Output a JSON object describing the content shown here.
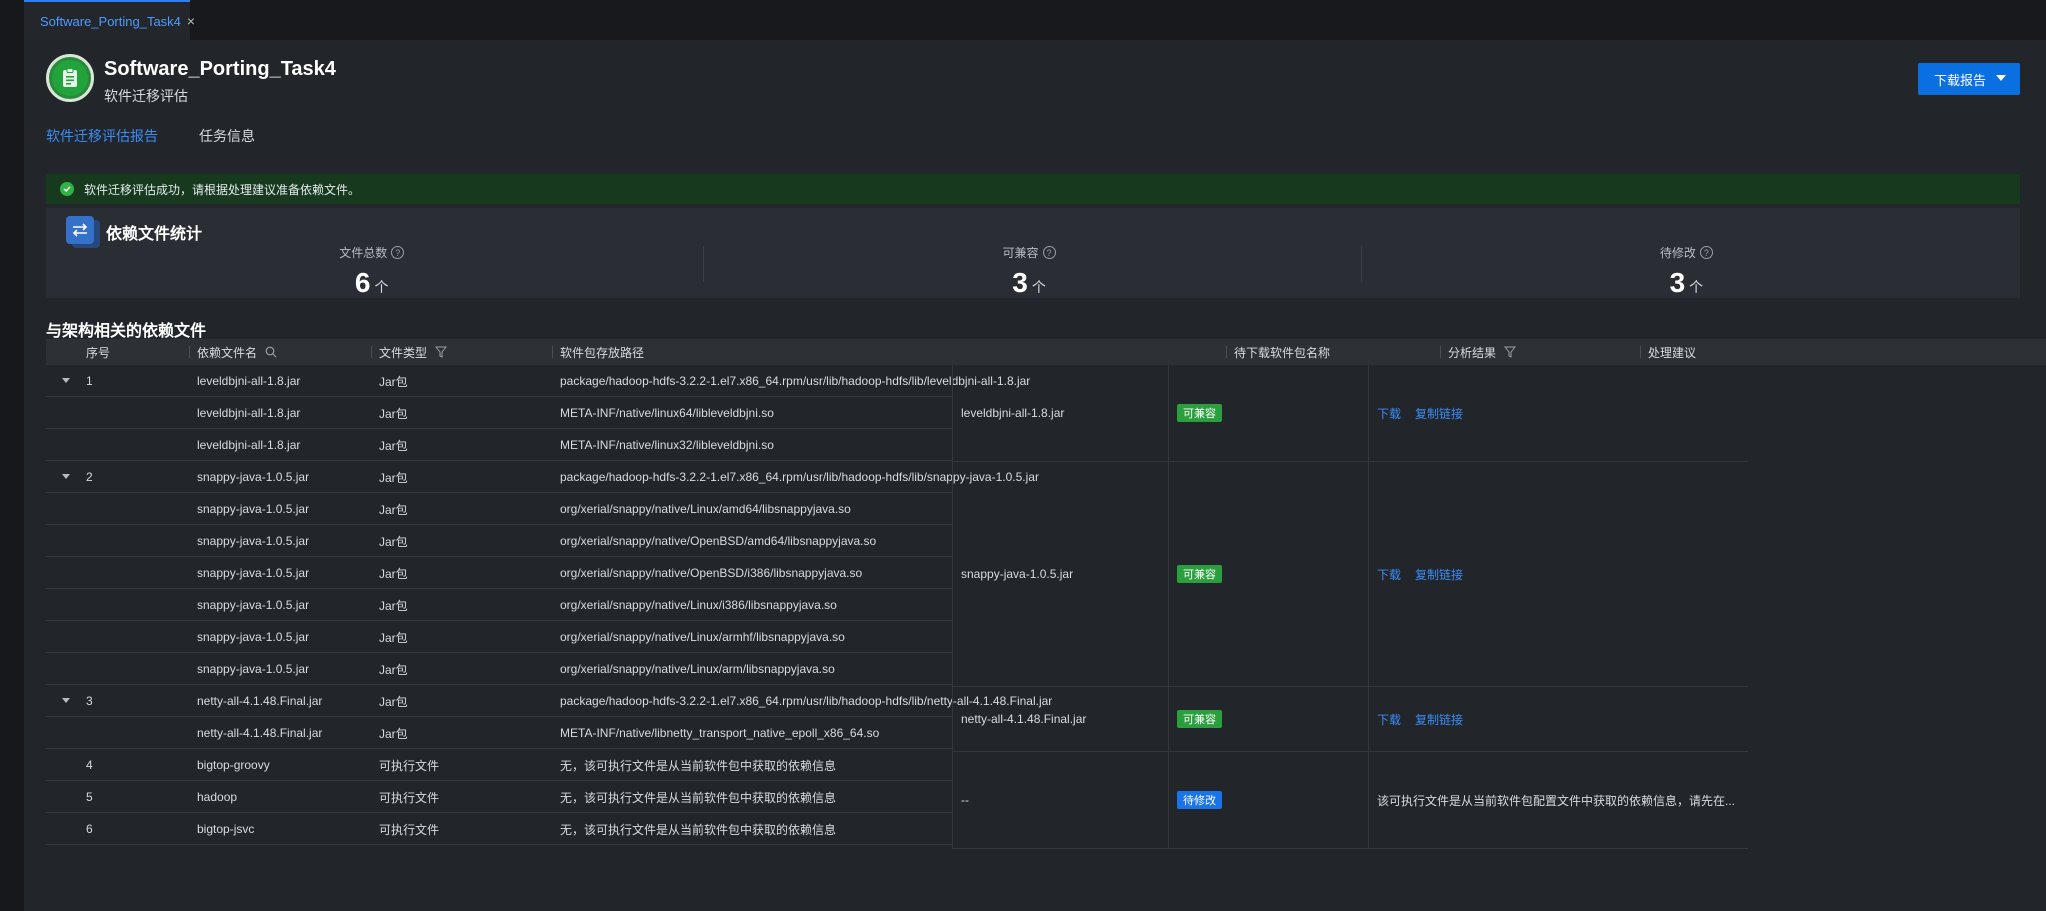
{
  "tab": {
    "label": "Software_Porting_Task4",
    "close": "×"
  },
  "header": {
    "title": "Software_Porting_Task4",
    "subtitle": "软件迁移评估",
    "download_label": "下载报告"
  },
  "tabs": [
    {
      "label": "软件迁移评估报告",
      "active": true
    },
    {
      "label": "任务信息",
      "active": false
    }
  ],
  "alert": {
    "text": "软件迁移评估成功，请根据处理建议准备依赖文件。"
  },
  "stats": {
    "title": "依赖文件统计",
    "items": [
      {
        "label": "文件总数",
        "value": "6",
        "arrow": "个"
      },
      {
        "label": "可兼容",
        "value": "3",
        "arrow": "个"
      },
      {
        "label": "待修改",
        "value": "3",
        "arrow": "个"
      }
    ]
  },
  "table": {
    "title": "与架构相关的依赖文件",
    "headers": [
      "序号",
      "依赖文件名",
      "文件类型",
      "软件包存放路径",
      "待下载软件包名称",
      "分析结果",
      "处理建议"
    ],
    "rows": [
      {
        "index": "1",
        "expand": true,
        "name": "leveldbjni-all-1.8.jar",
        "type": "Jar包",
        "path": "package/hadoop-hdfs-3.2.2-1.el7.x86_64.rpm/usr/lib/hadoop-hdfs/lib/leveldbjni-all-1.8.jar"
      },
      {
        "index": "",
        "expand": false,
        "name": "leveldbjni-all-1.8.jar",
        "type": "Jar包",
        "path": "META-INF/native/linux64/libleveldbjni.so"
      },
      {
        "index": "",
        "expand": false,
        "name": "leveldbjni-all-1.8.jar",
        "type": "Jar包",
        "path": "META-INF/native/linux32/libleveldbjni.so"
      },
      {
        "index": "2",
        "expand": true,
        "name": "snappy-java-1.0.5.jar",
        "type": "Jar包",
        "path": "package/hadoop-hdfs-3.2.2-1.el7.x86_64.rpm/usr/lib/hadoop-hdfs/lib/snappy-java-1.0.5.jar"
      },
      {
        "index": "",
        "expand": false,
        "name": "snappy-java-1.0.5.jar",
        "type": "Jar包",
        "path": "org/xerial/snappy/native/Linux/amd64/libsnappyjava.so"
      },
      {
        "index": "",
        "expand": false,
        "name": "snappy-java-1.0.5.jar",
        "type": "Jar包",
        "path": "org/xerial/snappy/native/OpenBSD/amd64/libsnappyjava.so"
      },
      {
        "index": "",
        "expand": false,
        "name": "snappy-java-1.0.5.jar",
        "type": "Jar包",
        "path": "org/xerial/snappy/native/OpenBSD/i386/libsnappyjava.so"
      },
      {
        "index": "",
        "expand": false,
        "name": "snappy-java-1.0.5.jar",
        "type": "Jar包",
        "path": "org/xerial/snappy/native/Linux/i386/libsnappyjava.so"
      },
      {
        "index": "",
        "expand": false,
        "name": "snappy-java-1.0.5.jar",
        "type": "Jar包",
        "path": "org/xerial/snappy/native/Linux/armhf/libsnappyjava.so"
      },
      {
        "index": "",
        "expand": false,
        "name": "snappy-java-1.0.5.jar",
        "type": "Jar包",
        "path": "org/xerial/snappy/native/Linux/arm/libsnappyjava.so"
      },
      {
        "index": "3",
        "expand": true,
        "name": "netty-all-4.1.48.Final.jar",
        "type": "Jar包",
        "path": "package/hadoop-hdfs-3.2.2-1.el7.x86_64.rpm/usr/lib/hadoop-hdfs/lib/netty-all-4.1.48.Final.jar"
      },
      {
        "index": "",
        "expand": false,
        "name": "netty-all-4.1.48.Final.jar",
        "type": "Jar包",
        "path": "META-INF/native/libnetty_transport_native_epoll_x86_64.so"
      },
      {
        "index": "4",
        "expand": false,
        "name": "bigtop-groovy",
        "type": "可执行文件",
        "path": "无，该可执行文件是从当前软件包中获取的依赖信息"
      },
      {
        "index": "5",
        "expand": false,
        "name": "hadoop",
        "type": "可执行文件",
        "path": "无，该可执行文件是从当前软件包中获取的依赖信息"
      },
      {
        "index": "6",
        "expand": false,
        "name": "bigtop-jsvc",
        "type": "可执行文件",
        "path": "无，该可执行文件是从当前软件包中获取的依赖信息"
      }
    ],
    "groups": [
      {
        "package": "leveldbjni-all-1.8.jar",
        "result": "可兼容",
        "result_kind": "ok",
        "download": "下载",
        "copy": "复制链接",
        "suggest": ""
      },
      {
        "package": "snappy-java-1.0.5.jar",
        "result": "可兼容",
        "result_kind": "ok",
        "download": "下载",
        "copy": "复制链接",
        "suggest": ""
      },
      {
        "package": "netty-all-4.1.48.Final.jar",
        "result": "可兼容",
        "result_kind": "ok",
        "download": "下载",
        "copy": "复制链接",
        "suggest": ""
      },
      {
        "package": "--",
        "result": "待修改",
        "result_kind": "mod",
        "download": "",
        "copy": "",
        "suggest": "该可执行文件是从当前软件包配置文件中获取的依赖信息，请先在..."
      }
    ]
  }
}
